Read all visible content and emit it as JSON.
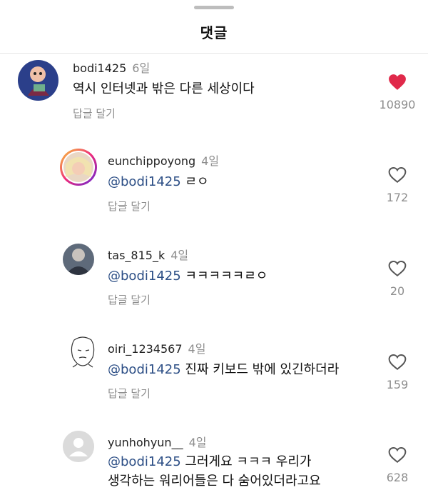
{
  "sheet": {
    "title": "댓글"
  },
  "colors": {
    "heart_active": "#e0294a",
    "mention": "#2d4f86",
    "muted": "#8e8e8e"
  },
  "comments": [
    {
      "username": "bodi1425",
      "time": "6일",
      "mention": "",
      "text": "역시 인터넷과 밖은 다른 세상이다",
      "reply_label": "답글 달기",
      "likes": "10890",
      "liked": true,
      "avatar_icon": "drawing-avatar"
    },
    {
      "username": "eunchippoyong",
      "time": "4일",
      "mention": "@bodi1425",
      "text": "ㄹㅇ",
      "reply_label": "답글 달기",
      "likes": "172",
      "liked": false,
      "avatar_icon": "photo-avatar-story-ring"
    },
    {
      "username": "tas_815_k",
      "time": "4일",
      "mention": "@bodi1425",
      "text": "ㅋㅋㅋㅋㅋㄹㅇ",
      "reply_label": "답글 달기",
      "likes": "20",
      "liked": false,
      "avatar_icon": "photo-avatar"
    },
    {
      "username": "oiri_1234567",
      "time": "4일",
      "mention": "@bodi1425",
      "text": "진짜 키보드 밖에 있긴하더라",
      "reply_label": "답글 달기",
      "likes": "159",
      "liked": false,
      "avatar_icon": "meme-face-avatar"
    },
    {
      "username": "yunhohyun__",
      "time": "4일",
      "mention": "@bodi1425",
      "text": "그러게요 ㅋㅋㅋ 우리가",
      "text_line2": "생각하는 워리어들은 다 숨어있더라고요",
      "likes": "628",
      "liked": false,
      "avatar_icon": "default-avatar"
    }
  ]
}
